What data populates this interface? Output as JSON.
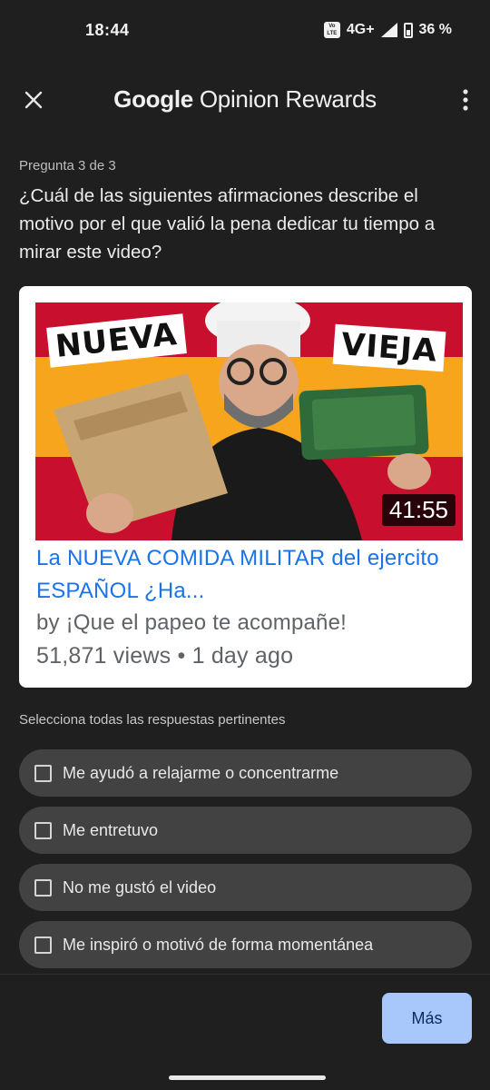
{
  "status_bar": {
    "time": "18:44",
    "volte": "Vo LTE",
    "network": "4G+",
    "battery": "36 %"
  },
  "app_bar": {
    "title_brand": "Google",
    "title_product": "Opinion Rewards",
    "close_icon": "close-icon",
    "menu_icon": "more-vert-icon"
  },
  "question": {
    "count": "Pregunta 3 de 3",
    "text": "¿Cuál de las siguientes afirmaciones describe el motivo por el que valió la pena dedicar tu tiempo a mirar este video?"
  },
  "video": {
    "thumb_label_new": "NUEVA",
    "thumb_label_old": "VIEJA",
    "duration": "41:55",
    "title": "La NUEVA COMIDA MILITAR del ejercito ESPAÑOL ¿Ha...",
    "channel": "by ¡Que el papeo te acompañe!",
    "meta": "51,871 views • 1 day ago"
  },
  "instruction": "Selecciona todas las respuestas pertinentes",
  "options": [
    {
      "label": "Me ayudó a relajarme o concentrarme",
      "checked": false
    },
    {
      "label": "Me entretuvo",
      "checked": false
    },
    {
      "label": "No me gustó el video",
      "checked": false
    },
    {
      "label": "Me inspiró o motivó de forma momentánea",
      "checked": false
    }
  ],
  "footer": {
    "more_button": "Más"
  },
  "colors": {
    "background": "#1f1f1f",
    "option_bg": "#424242",
    "primary_button": "#a8c7fa",
    "link_blue": "#1a73e8"
  }
}
